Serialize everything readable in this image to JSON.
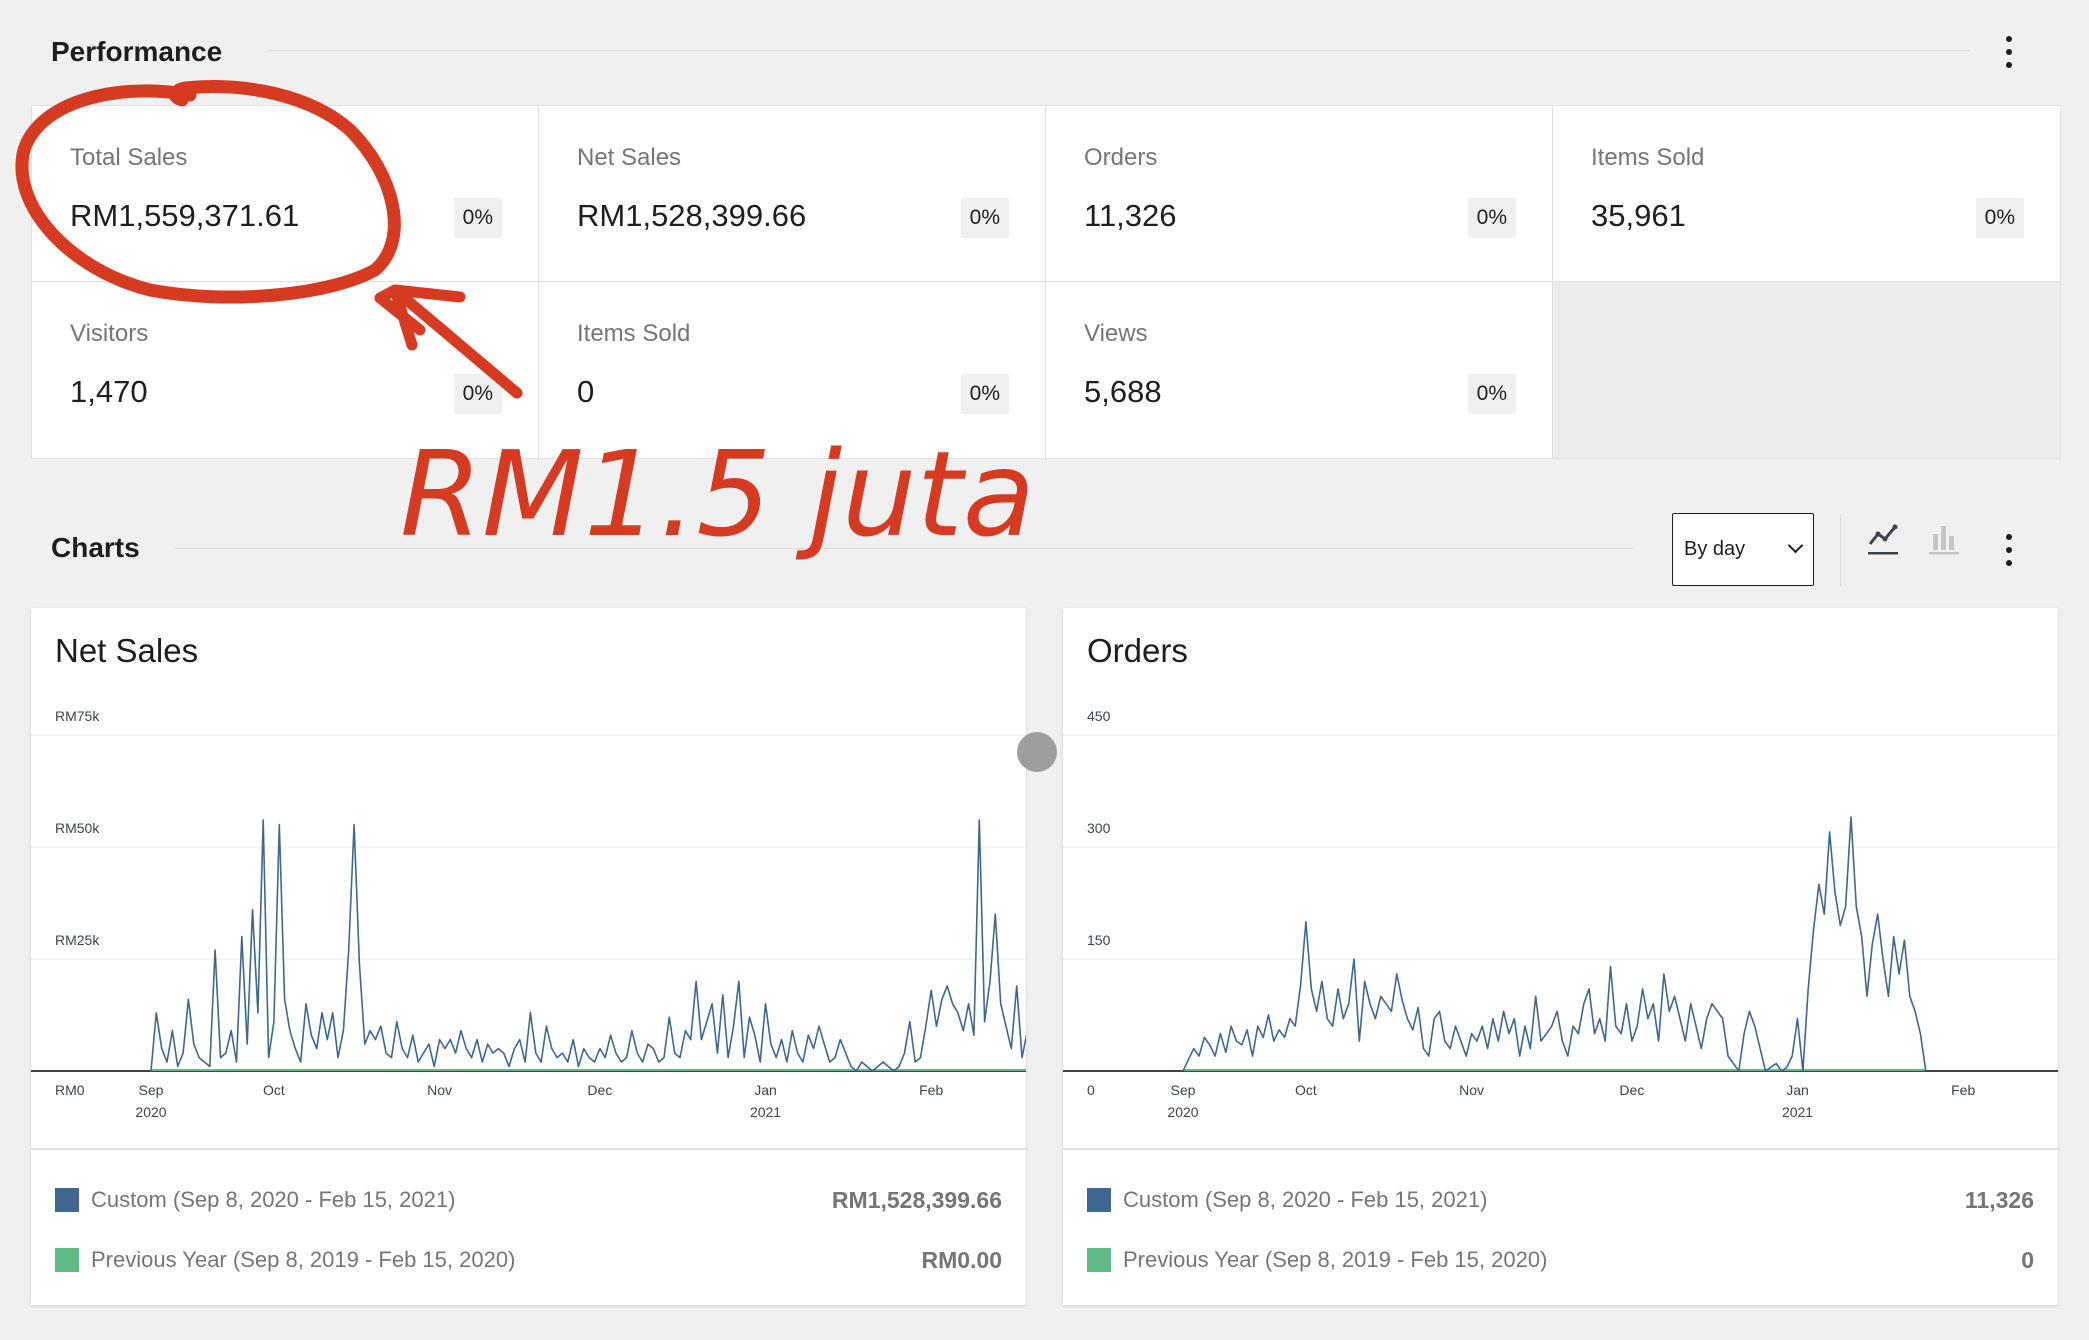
{
  "performance": {
    "title": "Performance",
    "tiles": [
      {
        "label": "Total Sales",
        "value": "RM1,559,371.61",
        "delta": "0%"
      },
      {
        "label": "Net Sales",
        "value": "RM1,528,399.66",
        "delta": "0%"
      },
      {
        "label": "Orders",
        "value": "11,326",
        "delta": "0%"
      },
      {
        "label": "Items Sold",
        "value": "35,961",
        "delta": "0%"
      },
      {
        "label": "Visitors",
        "value": "1,470",
        "delta": "0%"
      },
      {
        "label": "Items Sold",
        "value": "0",
        "delta": "0%"
      },
      {
        "label": "Views",
        "value": "5,688",
        "delta": "0%"
      }
    ]
  },
  "annotation": {
    "text": "RM1.5 juta",
    "color": "#d63a21"
  },
  "charts_section": {
    "title": "Charts",
    "interval_select": "By day",
    "line_chart_icon": "line-chart-icon",
    "bar_chart_icon": "bar-chart-icon"
  },
  "colors": {
    "primary_series": "#3e678f",
    "previous_series": "#5ebb85",
    "accent_annotation": "#d63a21"
  },
  "chart_data": [
    {
      "type": "line",
      "title": "Net Sales",
      "y_ticks": [
        "RM0",
        "RM25k",
        "RM50k",
        "RM75k"
      ],
      "ylim": [
        0,
        75000
      ],
      "x_ticks": [
        {
          "label": "Sep",
          "sub": "2020",
          "day": 0
        },
        {
          "label": "Oct",
          "sub": "",
          "day": 23
        },
        {
          "label": "Nov",
          "sub": "",
          "day": 54
        },
        {
          "label": "Dec",
          "sub": "",
          "day": 84
        },
        {
          "label": "Jan",
          "sub": "2021",
          "day": 115
        },
        {
          "label": "Feb",
          "sub": "",
          "day": 146
        }
      ],
      "x_range_days": [
        0,
        160
      ],
      "series": [
        {
          "name": "Custom (Sep 8, 2020 - Feb 15, 2021)",
          "total": "RM1,528,399.66",
          "values": [
            0,
            13000,
            5000,
            2000,
            9000,
            1000,
            4000,
            16000,
            6000,
            3000,
            2000,
            1000,
            27000,
            3000,
            4000,
            9000,
            2000,
            30000,
            6000,
            36000,
            13000,
            56000,
            3000,
            11000,
            55000,
            16000,
            9000,
            5000,
            2000,
            15000,
            8000,
            5000,
            13000,
            7000,
            13000,
            3000,
            9000,
            27000,
            55000,
            24000,
            6000,
            9000,
            7000,
            10000,
            4000,
            3000,
            11000,
            5000,
            3000,
            8000,
            2000,
            4000,
            6000,
            1000,
            7000,
            5000,
            7000,
            4000,
            9000,
            5000,
            3000,
            7000,
            2000,
            6000,
            4000,
            5000,
            4000,
            1000,
            5000,
            7000,
            2000,
            13000,
            4000,
            2000,
            10000,
            5000,
            3000,
            4000,
            2000,
            7000,
            1000,
            5000,
            3000,
            2000,
            5000,
            3000,
            8000,
            4000,
            2000,
            3000,
            9000,
            4000,
            2000,
            6000,
            5000,
            2000,
            3000,
            12000,
            4000,
            3000,
            9000,
            7000,
            20000,
            7000,
            11000,
            15000,
            4000,
            17000,
            3000,
            10000,
            20000,
            3000,
            12000,
            8000,
            2000,
            15000,
            6000,
            3000,
            7000,
            2000,
            9000,
            4000,
            2000,
            8000,
            5000,
            10000,
            6000,
            2000,
            3000,
            7000,
            4000,
            1000,
            0,
            2000,
            1000,
            0,
            1000,
            2000,
            1000,
            0,
            1000,
            4000,
            11000,
            2000,
            3000,
            10000,
            18000,
            10000,
            16000,
            19000,
            15000,
            13000,
            9000,
            15000,
            8000,
            56000,
            11000,
            20000,
            35000,
            15000,
            10000,
            5000,
            19000,
            3000,
            9000,
            4000,
            14000,
            6000,
            10000,
            4000,
            0
          ]
        },
        {
          "name": "Previous Year (Sep 8, 2019 - Feb 15, 2020)",
          "total": "RM0.00",
          "values": [
            0,
            0
          ]
        }
      ]
    },
    {
      "type": "line",
      "title": "Orders",
      "y_ticks": [
        "0",
        "150",
        "300",
        "450"
      ],
      "ylim": [
        0,
        450
      ],
      "x_ticks": [
        {
          "label": "Sep",
          "sub": "2020",
          "day": 0
        },
        {
          "label": "Oct",
          "sub": "",
          "day": 23
        },
        {
          "label": "Nov",
          "sub": "",
          "day": 54
        },
        {
          "label": "Dec",
          "sub": "",
          "day": 84
        },
        {
          "label": "Jan",
          "sub": "2021",
          "day": 115
        },
        {
          "label": "Feb",
          "sub": "",
          "day": 146
        }
      ],
      "x_range_days": [
        0,
        160
      ],
      "series": [
        {
          "name": "Custom (Sep 8, 2020 - Feb 15, 2021)",
          "total": "11,326",
          "values": [
            0,
            15,
            30,
            20,
            45,
            35,
            20,
            50,
            25,
            60,
            40,
            35,
            55,
            20,
            60,
            45,
            75,
            40,
            55,
            45,
            70,
            60,
            115,
            200,
            110,
            80,
            120,
            70,
            60,
            110,
            70,
            90,
            150,
            40,
            120,
            90,
            70,
            100,
            90,
            80,
            130,
            95,
            70,
            55,
            85,
            30,
            20,
            70,
            80,
            40,
            30,
            60,
            40,
            20,
            50,
            40,
            60,
            30,
            70,
            40,
            80,
            50,
            70,
            20,
            60,
            30,
            100,
            40,
            50,
            60,
            80,
            40,
            20,
            60,
            50,
            90,
            110,
            50,
            70,
            40,
            140,
            60,
            50,
            90,
            40,
            60,
            110,
            70,
            90,
            40,
            130,
            80,
            100,
            70,
            40,
            90,
            60,
            30,
            70,
            90,
            80,
            70,
            20,
            10,
            0,
            50,
            80,
            60,
            30,
            0,
            5,
            10,
            0,
            5,
            20,
            70,
            0,
            110,
            190,
            250,
            210,
            320,
            240,
            195,
            220,
            340,
            220,
            180,
            100,
            170,
            210,
            150,
            100,
            180,
            130,
            175,
            100,
            80,
            50,
            0
          ]
        },
        {
          "name": "Previous Year (Sep 8, 2019 - Feb 15, 2020)",
          "total": "0",
          "values": [
            0,
            0
          ]
        }
      ]
    }
  ]
}
